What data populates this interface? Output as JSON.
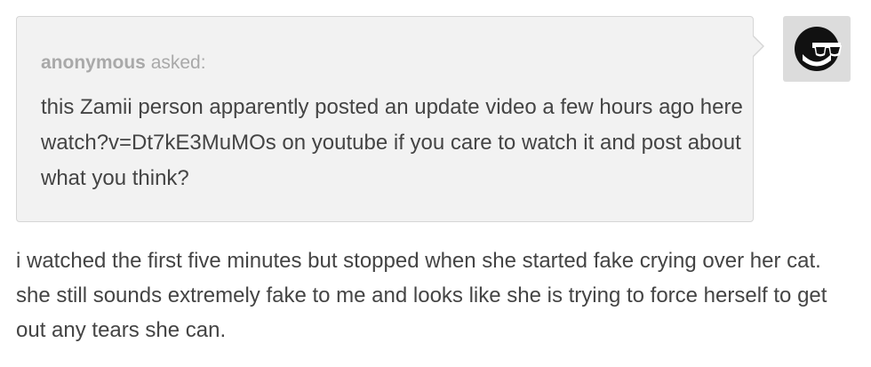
{
  "ask": {
    "asker_name": "anonymous",
    "asked_label": "asked:",
    "question": "this Zamii person apparently posted an update video a few hours ago here watch?v=Dt7kE3MuMOs on youtube if you care to watch it and post about what you think?"
  },
  "avatar": {
    "icon": "sunglasses-avatar-icon"
  },
  "answer": {
    "text": "i watched the first five minutes but stopped when she started fake crying over her cat. she still sounds extremely fake to me and looks like she is trying to force herself to get out any tears she can."
  },
  "colors": {
    "ask_background": "#f2f2f2",
    "ask_border": "#d6d6d6",
    "asker_text": "#a9a9a9",
    "body_text": "#444444",
    "avatar_background": "#dcdcdc"
  }
}
